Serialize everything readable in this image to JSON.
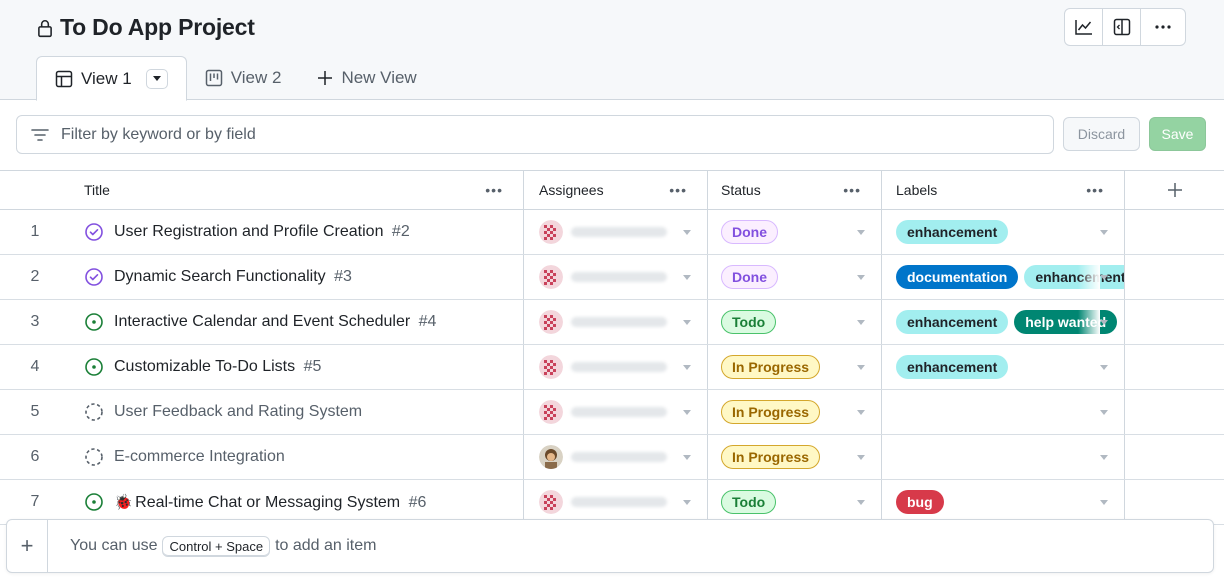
{
  "project": {
    "title": "To Do App Project"
  },
  "tabs": [
    {
      "label": "View 1",
      "icon": "table-icon",
      "active": true
    },
    {
      "label": "View 2",
      "icon": "board-icon",
      "active": false
    },
    {
      "label": "New View",
      "icon": "plus-icon",
      "active": false
    }
  ],
  "header_actions": [
    "insights-icon",
    "sidebar-panel-icon",
    "more-options-icon"
  ],
  "filter": {
    "placeholder": "Filter by keyword or by field"
  },
  "buttons": {
    "discard": "Discard",
    "save": "Save"
  },
  "columns": {
    "title": "Title",
    "assignees": "Assignees",
    "status": "Status",
    "labels": "Labels"
  },
  "rows": [
    {
      "num": "1",
      "state": "done",
      "title": "User Registration and Profile Creation",
      "issue": "#2",
      "avatar": "pink",
      "status": "Done",
      "status_type": "done",
      "labels": [
        {
          "text": "enhancement",
          "type": "enh"
        }
      ]
    },
    {
      "num": "2",
      "state": "done",
      "title": "Dynamic Search Functionality",
      "issue": "#3",
      "avatar": "pink",
      "status": "Done",
      "status_type": "done",
      "labels": [
        {
          "text": "documentation",
          "type": "doc"
        },
        {
          "text": "enhancement",
          "type": "enh"
        }
      ]
    },
    {
      "num": "3",
      "state": "open",
      "title": "Interactive Calendar and Event Scheduler",
      "issue": "#4",
      "avatar": "pink",
      "status": "Todo",
      "status_type": "todo",
      "labels": [
        {
          "text": "enhancement",
          "type": "enh"
        },
        {
          "text": "help wanted",
          "type": "help"
        }
      ]
    },
    {
      "num": "4",
      "state": "open",
      "title": "Customizable To-Do Lists",
      "issue": "#5",
      "avatar": "pink",
      "status": "In Progress",
      "status_type": "prog",
      "labels": [
        {
          "text": "enhancement",
          "type": "enh"
        }
      ]
    },
    {
      "num": "5",
      "state": "draft",
      "title": "User Feedback and Rating System",
      "issue": "",
      "avatar": "pink",
      "status": "In Progress",
      "status_type": "prog",
      "labels": []
    },
    {
      "num": "6",
      "state": "draft",
      "title": "E-commerce Integration",
      "issue": "",
      "avatar": "photo",
      "status": "In Progress",
      "status_type": "prog",
      "labels": []
    },
    {
      "num": "7",
      "state": "open",
      "title": "Real-time Chat or Messaging System",
      "issue": "#6",
      "emoji": "🐞",
      "avatar": "pink",
      "status": "Todo",
      "status_type": "todo",
      "labels": [
        {
          "text": "bug",
          "type": "bug"
        }
      ]
    }
  ],
  "add_item": {
    "prefix": "You can use",
    "shortcut": "Control + Space",
    "suffix": "to add an item"
  },
  "colors": {
    "done": "#8250df",
    "open": "#1a7f37",
    "draft": "#57606a",
    "enhancement": "#a2eeef",
    "documentation": "#0075ca",
    "help_wanted": "#008672",
    "bug": "#d73a4a"
  }
}
